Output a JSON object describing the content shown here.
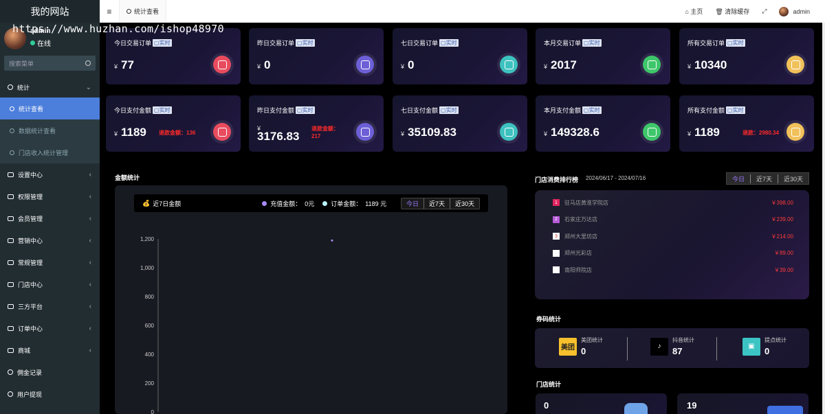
{
  "sidebar": {
    "brand": "我的网站",
    "user": {
      "name": "admin",
      "status": "在线"
    },
    "search_placeholder": "搜索菜单",
    "items": [
      {
        "label": "统计",
        "expanded": true
      },
      {
        "label": "统计查看",
        "sub": true,
        "active": true
      },
      {
        "label": "数据统计查看",
        "sub": true
      },
      {
        "label": "门店收入统计管理",
        "sub": true
      },
      {
        "label": "设置中心"
      },
      {
        "label": "权限管理"
      },
      {
        "label": "会员管理"
      },
      {
        "label": "营销中心"
      },
      {
        "label": "常规管理"
      },
      {
        "label": "门店中心"
      },
      {
        "label": "三方平台"
      },
      {
        "label": "订单中心"
      },
      {
        "label": "商城"
      },
      {
        "label": "佣金记录"
      },
      {
        "label": "用户提现"
      }
    ]
  },
  "watermark": "https://www.huzhan.com/ishop48970",
  "topbar": {
    "menu_icon": "≡",
    "tab_label": "统计查看",
    "home": "主页",
    "clear_cache": "清除缓存",
    "user": "admin"
  },
  "realtime_badge": "实时",
  "currency": "¥",
  "trade_cards": [
    {
      "title": "今日交易订单",
      "value": "77",
      "color": "#e84b5e"
    },
    {
      "title": "昨日交易订单",
      "value": "0",
      "color": "#6d5fd6"
    },
    {
      "title": "七日交易订单",
      "value": "0",
      "color": "#3dc2c0"
    },
    {
      "title": "本月交易订单",
      "value": "2017",
      "color": "#3ec76a"
    },
    {
      "title": "所有交易订单",
      "value": "10340",
      "color": "#f1c15a"
    }
  ],
  "pay_cards": [
    {
      "title": "今日支付金额",
      "value": "1189",
      "refund": "退款金额：136",
      "color": "#e84b5e"
    },
    {
      "title": "昨日支付金额",
      "value": "3176.83",
      "refund_line1": "退款金额：",
      "refund_line2": "217",
      "color": "#6d5fd6"
    },
    {
      "title": "七日支付金额",
      "value": "35109.83",
      "color": "#3dc2c0"
    },
    {
      "title": "本月支付金额",
      "value": "149328.6",
      "color": "#3ec76a"
    },
    {
      "title": "所有支付金额",
      "value": "1189",
      "refund": "退款：2980.34",
      "color": "#f1c15a"
    }
  ],
  "amount_stats": {
    "title": "金额统计",
    "legend_title": "近7日金额",
    "recharge_label": "充值金额：",
    "recharge_value": "0元",
    "order_label": "订单金额：",
    "order_value": "1189 元",
    "tabs": [
      "今日",
      "近7天",
      "近30天"
    ],
    "recharge_color": "#a78bfa",
    "order_color": "#b9f3ff"
  },
  "chart_data": {
    "type": "line",
    "y_ticks": [
      "1,200",
      "1,000",
      "800",
      "600",
      "400",
      "200",
      "0"
    ],
    "ylim": [
      0,
      1200
    ],
    "series": [
      {
        "name": "订单金额",
        "values": [
          1189
        ]
      }
    ]
  },
  "ranking": {
    "title": "门店消费排行榜",
    "date_range": "2024/06/17 - 2024/07/16",
    "tabs": [
      "今日",
      "近7天",
      "近30天"
    ],
    "rows": [
      {
        "rank": "1",
        "name": "驻马店黄淮学院店",
        "amount": "￥398.00",
        "color": "#e0245e"
      },
      {
        "rank": "2",
        "name": "石家庄万达店",
        "amount": "￥239.00",
        "color": "#b65ad8"
      },
      {
        "rank": "3",
        "name": "郑州大里坊店",
        "amount": "￥214.00",
        "color": "#ffffff"
      },
      {
        "rank": "",
        "name": "郑州光彩店",
        "amount": "￥89.00",
        "color": "#ffffff"
      },
      {
        "rank": "",
        "name": "南阳师院店",
        "amount": "￥39.00",
        "color": "#ffffff"
      }
    ]
  },
  "coupons": {
    "title": "券码统计",
    "items": [
      {
        "label": "美团统计",
        "value": "0",
        "icon_text": "美团"
      },
      {
        "label": "抖音统计",
        "value": "87",
        "icon_text": "♪"
      },
      {
        "label": "提点统计",
        "value": "0",
        "icon_text": "▣"
      }
    ]
  },
  "store_stats": {
    "title": "门店统计",
    "values": [
      "0",
      "19"
    ]
  }
}
